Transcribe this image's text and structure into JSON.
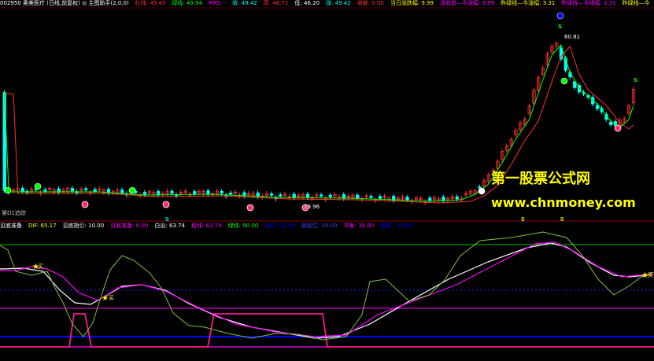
{
  "header": {
    "stock": "002950 奥美医疗 (日线,前复权) ◎ 主图助手(2,0,0)",
    "fields": [
      {
        "text": "红线: 49.45",
        "color": "#ff3030"
      },
      {
        "text": "绿线: 49.94",
        "color": "#00ff00"
      },
      {
        "text": "MK5: -",
        "color": "#ff00ff"
      },
      {
        "text": "收: 49.42",
        "color": "#00ffff"
      },
      {
        "text": "高: 46.72",
        "color": "#ff3030"
      },
      {
        "text": "低: 46.20",
        "color": "#ffffff"
      },
      {
        "text": "涨: 49.42",
        "color": "#00ffff"
      },
      {
        "text": "突破: 0.00",
        "color": "#ff3030"
      },
      {
        "text": "当日涨跌幅: 9.99",
        "color": "#ffff00"
      },
      {
        "text": "涨收盘—今涨幅: 9.99",
        "color": "#ff00ff"
      },
      {
        "text": "昨绿线—今涨幅: 3.31",
        "color": "#ffff00"
      },
      {
        "text": "昨绿线—今绿幅: 3.31",
        "color": "#ff00ff"
      },
      {
        "text": "昨绿线—今",
        "color": "#ffff00"
      }
    ]
  },
  "main_chart": {
    "high_label": "60.81",
    "low_label": "19.96",
    "signal_label": "S",
    "bottom_left_label": "第D1追踪",
    "bottom_markers": [
      "B",
      "B",
      "B"
    ],
    "colors": {
      "up": "#ff3030",
      "down": "#00ffff",
      "red_line": "#ff3030",
      "green_line": "#00ff00"
    }
  },
  "indicator": {
    "fields": [
      {
        "text": "见底准备",
        "color": "#ffffff"
      },
      {
        "text": "DIF: 65.17",
        "color": "#ffff00"
      },
      {
        "text": "见底指引: 10.00",
        "color": "#ffffff"
      },
      {
        "text": "见底准备: 0.00",
        "color": "#ff00ff"
      },
      {
        "text": "白出: 63.74",
        "color": "#ffffff"
      },
      {
        "text": "粉线: 63.74",
        "color": "#ff00ff"
      },
      {
        "text": "绿线: 90.00",
        "color": "#00ff00"
      },
      {
        "text": "低位: 10.00",
        "color": "#0000ff"
      },
      {
        "text": "超低位: 10.00",
        "color": "#4040ff"
      },
      {
        "text": "平衡: 35.00",
        "color": "#ff00ff"
      },
      {
        "text": "超跌: -10.00",
        "color": "#0000ff"
      }
    ],
    "star_label": "买",
    "right_label": "买"
  },
  "watermark": {
    "title": "第一股票公式网",
    "url": "www.chnmoney.com"
  }
}
